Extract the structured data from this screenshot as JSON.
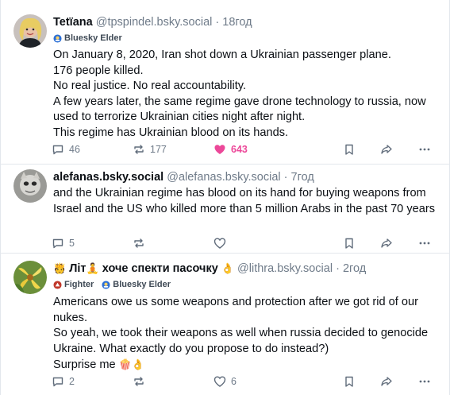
{
  "colors": {
    "accent_like": "#ec4899",
    "muted": "#6f7b89",
    "text": "#0b0f14",
    "divider": "#e3e7ec",
    "icon": "#5f6b7a"
  },
  "posts": [
    {
      "display_name": "Tetïana",
      "handle": "@tpspindel.bsky.social",
      "separator": "·",
      "time": "18год",
      "badges": [
        {
          "icon": "elder-badge-icon",
          "label": "Bluesky Elder"
        }
      ],
      "body_lines": [
        "On January 8, 2020, Iran shot down a Ukrainian passenger plane.",
        "176 people killed.",
        "No real justice. No real accountability.",
        "A few years later, the same regime gave drone technology to russia, now used to terrorize Ukrainian cities night after night.",
        "This regime has Ukrainian blood on its hands."
      ],
      "replies": "46",
      "reposts": "177",
      "likes": "643",
      "liked": true
    },
    {
      "display_name": "alefanas.bsky.social",
      "handle": "@alefanas.bsky.social",
      "separator": "·",
      "time": "7год",
      "badges": [],
      "body_lines": [
        "and the Ukrainian regime has blood on its hand for buying weapons from Israel and the US who killed more than 5 million Arabs in the past 70 years"
      ],
      "replies": "5",
      "reposts": "",
      "likes": "",
      "liked": false
    },
    {
      "display_name_prefix": "🫅",
      "display_name_part1": "Літ",
      "display_name_emoji1": "🧘",
      "display_name_part2": "хоче спекти пасочку",
      "display_name_emoji2": "👌",
      "handle": "@lithra.bsky.social",
      "separator": "·",
      "time": "2год",
      "badges": [
        {
          "icon": "fighter-badge-icon",
          "label": "Fighter"
        },
        {
          "icon": "elder-badge-icon",
          "label": "Bluesky Elder"
        }
      ],
      "body_lines": [
        "Americans owe us some weapons and protection after we got rid of our nukes.",
        "So yeah, we took their weapons as well when russia decided to genocide Ukraine. What exactly do you propose to do instead?)"
      ],
      "body_last_text": "Surprise me",
      "body_last_emoji": "🍿👌",
      "replies": "2",
      "reposts": "",
      "likes": "6",
      "liked": false
    }
  ]
}
